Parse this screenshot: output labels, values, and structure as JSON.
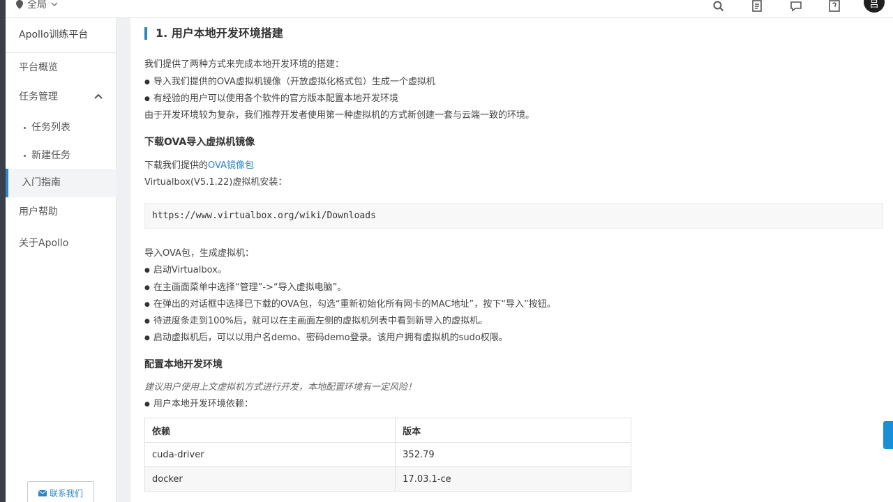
{
  "topbar": {
    "region_label": "全局",
    "avatar_text": "吕",
    "icons": [
      "search-icon",
      "document-icon",
      "chat-icon",
      "help-icon"
    ]
  },
  "sidebar": {
    "title": "Apollo训练平台",
    "items": [
      {
        "label": "平台概览"
      },
      {
        "label": "任务管理"
      },
      {
        "label": "任务列表"
      },
      {
        "label": "新建任务"
      },
      {
        "label": "入门指南"
      },
      {
        "label": "用户帮助"
      },
      {
        "label": "关于Apollo"
      }
    ],
    "contact_label": "联系我们"
  },
  "content": {
    "heading": "1. 用户本地开发环境搭建",
    "intro": "我们提供了两种方式来完成本地开发环境的搭建：",
    "intro_bullets": [
      "导入我们提供的OVA虚拟机镜像（开放虚拟化格式包）生成一个虚拟机",
      "有经验的用户可以使用各个软件的官方版本配置本地开发环境"
    ],
    "recommend": "由于开发环境较为复杂，我们推荐开发者使用第一种虚拟机的方式新创建一套与云端一致的环境。",
    "section_download": "下载OVA导入虚拟机镜像",
    "download_prefix": "下载我们提供的",
    "download_link": "OVA镜像包",
    "virtualbox_install": "Virtualbox(V5.1.22)虚拟机安装：",
    "code_url": "https://www.virtualbox.org/wiki/Downloads",
    "import_title": "导入OVA包，生成虚拟机：",
    "import_steps": [
      "启动Virtualbox。",
      "在主画面菜单中选择“管理”->“导入虚拟电脑”。",
      "在弹出的对话框中选择已下载的OVA包，勾选“重新初始化所有网卡的MAC地址”，按下“导入”按钮。",
      "待进度条走到100%后，就可以在主画面左侧的虚拟机列表中看到新导入的虚拟机。",
      "启动虚拟机后，可以以用户名demo、密码demo登录。该用户拥有虚拟机的sudo权限。"
    ],
    "section_config": "配置本地开发环境",
    "warning": "建议用户使用上文虚拟机方式进行开发，本地配置环境有一定风险！",
    "deps_intro": "用户本地开发环境依赖：",
    "table": {
      "headers": [
        "依赖",
        "版本"
      ],
      "rows": [
        [
          "cuda-driver",
          "352.79"
        ],
        [
          "docker",
          "17.03.1-ce"
        ]
      ]
    }
  },
  "colors": {
    "accent": "#2b86c5",
    "sidebar_strip": "#3a3f4a",
    "float_button": "#1890d8"
  }
}
